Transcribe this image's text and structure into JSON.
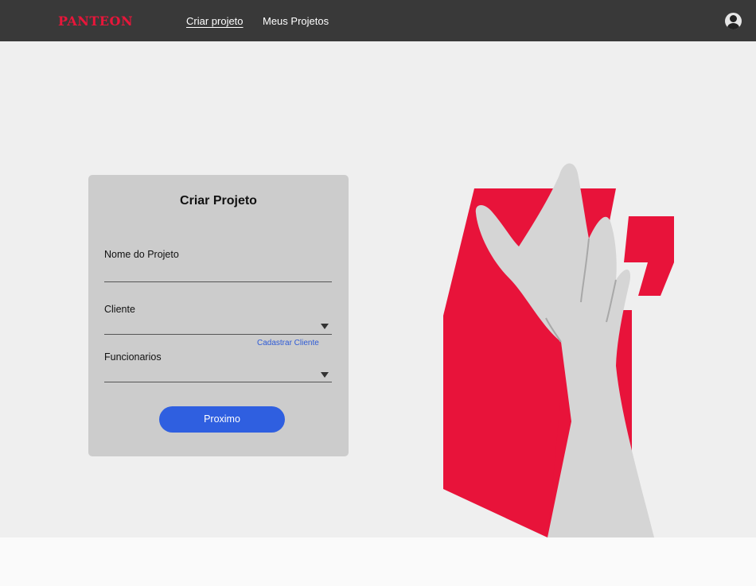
{
  "header": {
    "logo": "PANTEON",
    "nav": [
      {
        "label": "Criar projeto"
      },
      {
        "label": "Meus Projetos"
      }
    ]
  },
  "form": {
    "title": "Criar Projeto",
    "project_name_label": "Nome do Projeto",
    "project_name_value": "",
    "client_label": "Cliente",
    "client_value": "",
    "register_client_link": "Cadastrar Cliente",
    "employees_label": "Funcionarios",
    "employees_value": "",
    "next_button": "Proximo"
  },
  "colors": {
    "header_bg": "#393939",
    "brand_red": "#e8163a",
    "primary_blue": "#2f5fe0",
    "card_bg": "#cccccc",
    "hero_bg": "#efefef"
  },
  "icons": {
    "profile": "user-avatar-icon",
    "dropdown": "caret-down-icon"
  }
}
